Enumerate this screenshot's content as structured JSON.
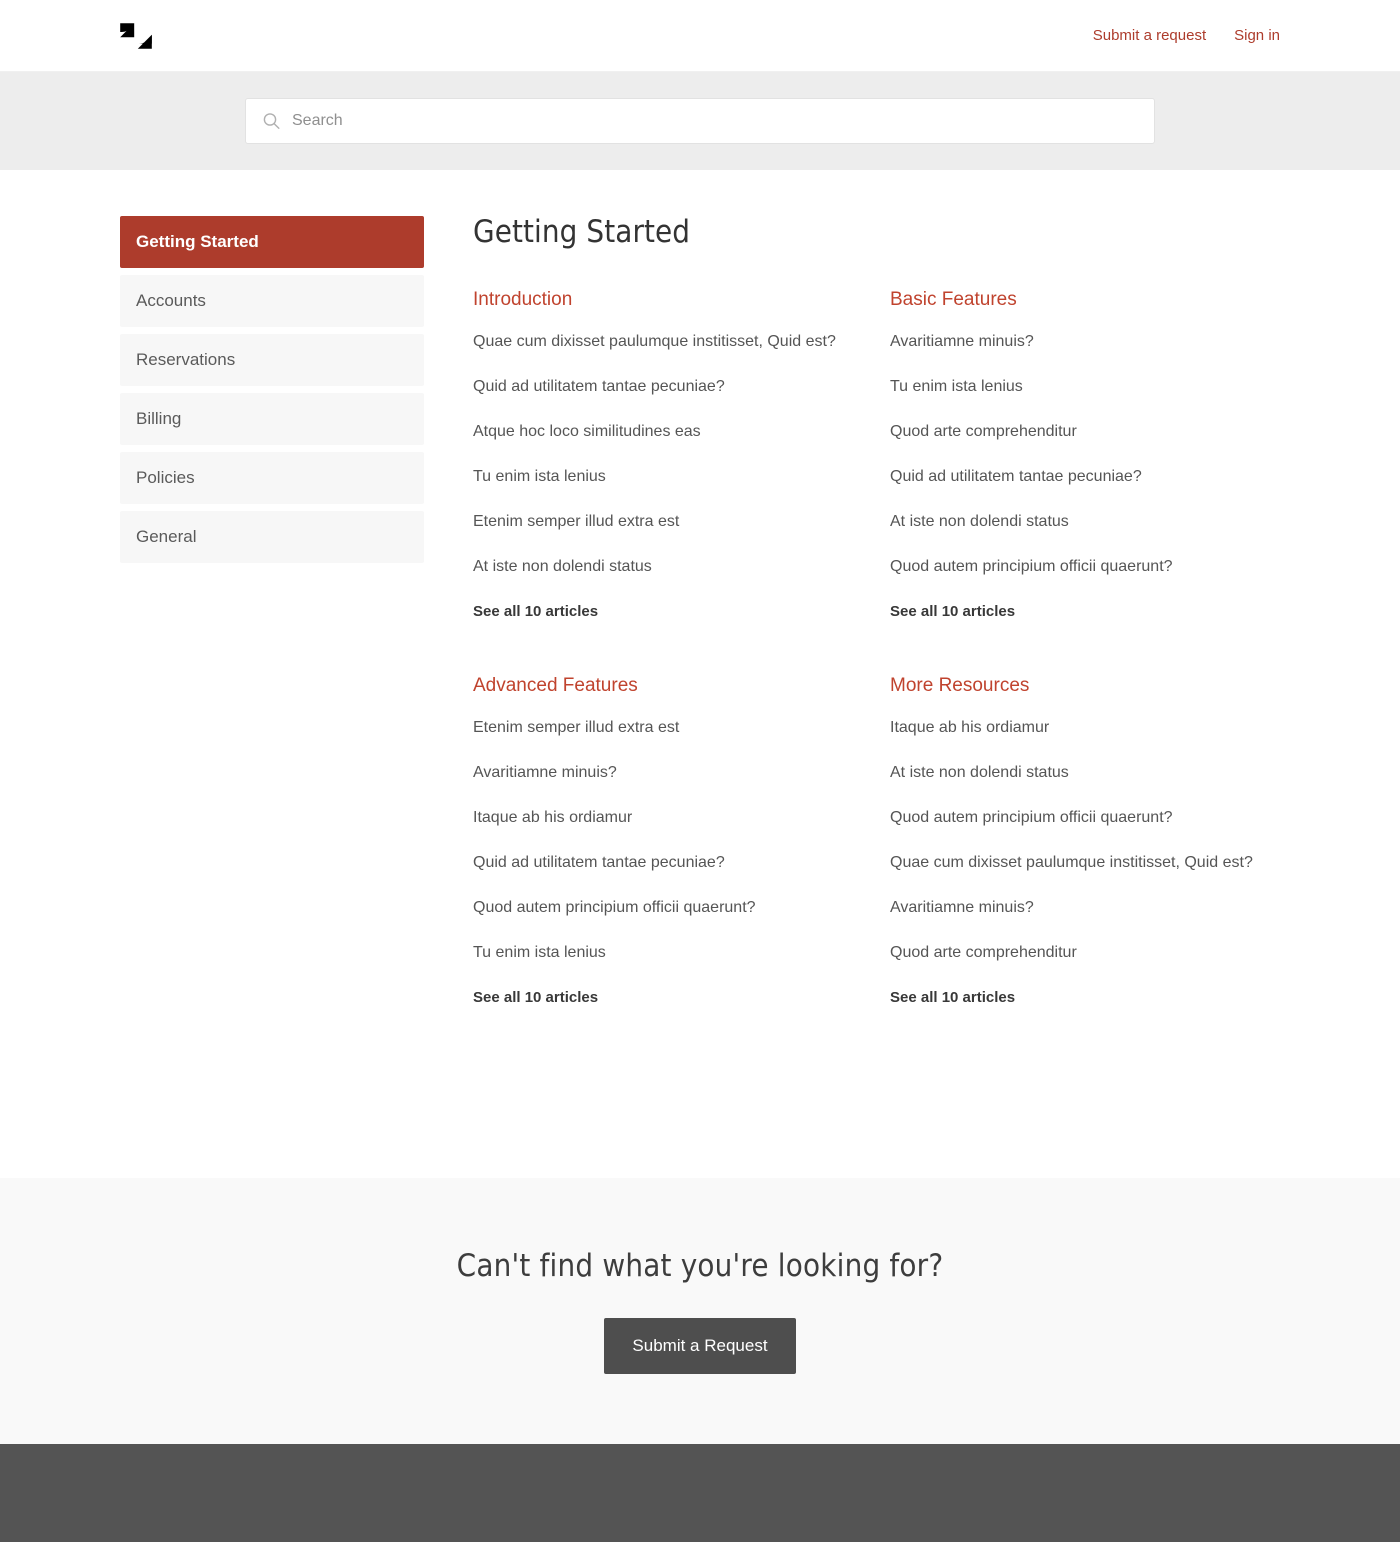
{
  "header": {
    "logo_name": "zendesk-logo",
    "links": [
      {
        "label": "Submit a request",
        "name": "submit-a-request-link"
      },
      {
        "label": "Sign in",
        "name": "sign-in-link"
      }
    ]
  },
  "search": {
    "placeholder": "Search",
    "value": "",
    "icon": "search-icon"
  },
  "sidebar": {
    "items": [
      {
        "label": "Getting Started",
        "active": true
      },
      {
        "label": "Accounts",
        "active": false
      },
      {
        "label": "Reservations",
        "active": false
      },
      {
        "label": "Billing",
        "active": false
      },
      {
        "label": "Policies",
        "active": false
      },
      {
        "label": "General",
        "active": false
      }
    ]
  },
  "main": {
    "title": "Getting Started",
    "sections": [
      {
        "title": "Introduction",
        "articles": [
          "Quae cum dixisset paulumque institisset, Quid est?",
          "Quid ad utilitatem tantae pecuniae?",
          "Atque hoc loco similitudines eas",
          "Tu enim ista lenius",
          "Etenim semper illud extra est",
          "At iste non dolendi status"
        ],
        "see_all": "See all 10 articles"
      },
      {
        "title": "Basic Features",
        "articles": [
          "Avaritiamne minuis?",
          "Tu enim ista lenius",
          "Quod arte comprehenditur",
          "Quid ad utilitatem tantae pecuniae?",
          "At iste non dolendi status",
          "Quod autem principium officii quaerunt?"
        ],
        "see_all": "See all 10 articles"
      },
      {
        "title": "Advanced Features",
        "articles": [
          "Etenim semper illud extra est",
          "Avaritiamne minuis?",
          "Itaque ab his ordiamur",
          "Quid ad utilitatem tantae pecuniae?",
          "Quod autem principium officii quaerunt?",
          "Tu enim ista lenius"
        ],
        "see_all": "See all 10 articles"
      },
      {
        "title": "More Resources",
        "articles": [
          "Itaque ab his ordiamur",
          "At iste non dolendi status",
          "Quod autem principium officii quaerunt?",
          "Quae cum dixisset paulumque institisset, Quid est?",
          "Avaritiamne minuis?",
          "Quod arte comprehenditur"
        ],
        "see_all": "See all 10 articles"
      }
    ]
  },
  "cta": {
    "heading": "Can't find what you're looking for?",
    "button_label": "Submit a Request"
  },
  "colors": {
    "brand_red": "#ad3c2c",
    "section_heading_red": "#c0432e",
    "search_band_bg": "#ededed",
    "sidebar_item_bg": "#f7f7f7",
    "cta_band_bg": "#f9f9f9",
    "cta_button_bg": "#4e4e4e",
    "footer_bg": "#545454"
  }
}
